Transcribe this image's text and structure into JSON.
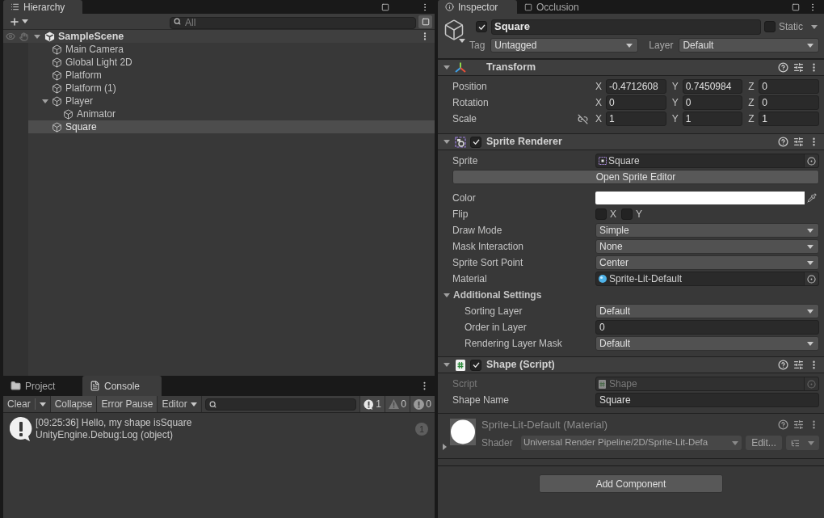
{
  "hierarchy": {
    "tab": {
      "label": "Hierarchy",
      "kind": "hierarchy",
      "selected": true
    },
    "search": {
      "placeholder": "All"
    },
    "scene": {
      "name": "SampleScene",
      "expanded": true
    },
    "items": [
      {
        "name": "Main Camera",
        "selected": false
      },
      {
        "name": "Global Light 2D",
        "selected": false
      },
      {
        "name": "Platform",
        "selected": false
      },
      {
        "name": "Platform (1)",
        "selected": false
      },
      {
        "name": "Player",
        "selected": false,
        "expanded": true,
        "children": [
          {
            "name": "Animator",
            "selected": false
          }
        ]
      },
      {
        "name": "Square",
        "selected": true
      }
    ]
  },
  "console": {
    "tabs": [
      {
        "label": "Project",
        "kind": "project",
        "selected": false
      },
      {
        "label": "Console",
        "kind": "console",
        "selected": true
      }
    ],
    "toolbar": [
      {
        "kind": "split",
        "label": "Clear"
      },
      {
        "kind": "toggle",
        "label": "Collapse",
        "on": true
      },
      {
        "kind": "toggle",
        "label": "Error Pause",
        "on": true
      },
      {
        "kind": "dropdown",
        "label": "Editor"
      }
    ],
    "counters": [
      {
        "kind": "info",
        "count": "1"
      },
      {
        "kind": "warning",
        "count": "0"
      },
      {
        "kind": "error",
        "count": "0"
      }
    ],
    "entries": [
      {
        "kind": "info",
        "message": "[09:25:36] Hello, my shape isSquare",
        "stack": "UnityEngine.Debug:Log (object)",
        "count": "1"
      }
    ]
  },
  "inspector": {
    "tabs": [
      {
        "label": "Inspector",
        "kind": "inspector",
        "selected": true
      },
      {
        "label": "Occlusion",
        "kind": "occlusion",
        "selected": false
      }
    ],
    "object": {
      "active": true,
      "name": "Square",
      "static": false,
      "static_label": "Static",
      "tag_label": "Tag",
      "tag": "Untagged",
      "layer_label": "Layer",
      "layer": "Default"
    },
    "components": [
      {
        "kind": "transform",
        "title": "Transform",
        "expanded": true,
        "rows": [
          {
            "label": "Position",
            "values": [
              {
                "axis": "X",
                "value": "-0.4712608"
              },
              {
                "axis": "Y",
                "value": "0.7450984"
              },
              {
                "axis": "Z",
                "value": "0"
              }
            ]
          },
          {
            "label": "Rotation",
            "values": [
              {
                "axis": "X",
                "value": "0"
              },
              {
                "axis": "Y",
                "value": "0"
              },
              {
                "axis": "Z",
                "value": "0"
              }
            ]
          },
          {
            "label": "Scale",
            "proportions_linked": false,
            "values": [
              {
                "axis": "X",
                "value": "1"
              },
              {
                "axis": "Y",
                "value": "1"
              },
              {
                "axis": "Z",
                "value": "1"
              }
            ]
          }
        ]
      },
      {
        "kind": "sprite-renderer",
        "title": "Sprite Renderer",
        "enabled": true,
        "expanded": true,
        "fields": [
          {
            "kind": "sprite",
            "label": "Sprite",
            "value": "Square"
          },
          {
            "kind": "button",
            "label": "Open Sprite Editor"
          },
          {
            "kind": "color",
            "label": "Color",
            "color": "#ffffff"
          },
          {
            "kind": "flip",
            "label": "Flip",
            "options": [
              {
                "label": "X",
                "checked": false
              },
              {
                "label": "Y",
                "checked": false
              }
            ]
          },
          {
            "kind": "dropdown",
            "label": "Draw Mode",
            "value": "Simple"
          },
          {
            "kind": "dropdown",
            "label": "Mask Interaction",
            "value": "None"
          },
          {
            "kind": "dropdown",
            "label": "Sprite Sort Point",
            "value": "Center"
          },
          {
            "kind": "material",
            "label": "Material",
            "value": "Sprite-Lit-Default"
          },
          {
            "kind": "foldout",
            "label": "Additional Settings",
            "expanded": true,
            "children": [
              {
                "kind": "dropdown",
                "label": "Sorting Layer",
                "value": "Default"
              },
              {
                "kind": "text",
                "label": "Order in Layer",
                "value": "0"
              },
              {
                "kind": "dropdown",
                "label": "Rendering Layer Mask",
                "value": "Default"
              }
            ]
          }
        ]
      },
      {
        "kind": "script",
        "title": "Shape (Script)",
        "enabled": true,
        "expanded": true,
        "fields": [
          {
            "kind": "script",
            "label": "Script",
            "value": "Shape",
            "disabled": true
          },
          {
            "kind": "text",
            "label": "Shape Name",
            "value": "Square",
            "disabled": false
          }
        ]
      },
      {
        "kind": "material",
        "title": "Sprite-Lit-Default (Material)",
        "expanded": false,
        "shader_label": "Shader",
        "shader": "Universal Render Pipeline/2D/Sprite-Lit-Defa",
        "edit_label": "Edit..."
      }
    ],
    "add_component": "Add Component"
  }
}
